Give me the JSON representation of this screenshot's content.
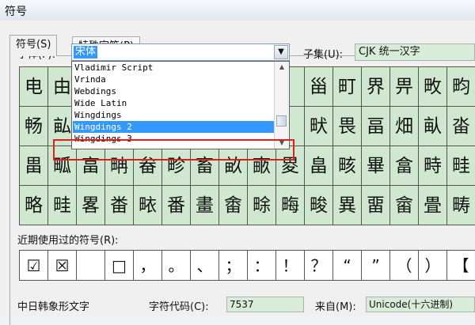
{
  "window": {
    "title": "符号"
  },
  "tabs": [
    {
      "label": "符号(S)"
    },
    {
      "label": "特殊字符(P)"
    }
  ],
  "font": {
    "label": "字体(F):",
    "selected": "宋体",
    "options": [
      "Vladimir Script",
      "Vrinda",
      "Webdings",
      "Wide Latin",
      "Wingdings",
      "Wingdings 2",
      "Wingdings 3"
    ],
    "highlighted": "Wingdings 2"
  },
  "subset": {
    "label": "子集(U):",
    "value": "CJK 统一汉字"
  },
  "symbol_grid": {
    "rows": [
      [
        "电",
        "由",
        "",
        "",
        "",
        "",
        "",
        "",
        "",
        "",
        "甾",
        "町",
        "界",
        "畀",
        "畋",
        "畇"
      ],
      [
        "畅",
        "畆",
        "",
        "",
        "",
        "",
        "",
        "",
        "",
        "",
        "畎",
        "畏",
        "畐",
        "畑",
        "畒",
        "畓"
      ],
      [
        "畕",
        "畖",
        "畗",
        "畘",
        "畚",
        "畛",
        "畜",
        "畝",
        "畞",
        "畟",
        "畠",
        "畡",
        "畢",
        "畣",
        "畤",
        "畦"
      ],
      [
        "略",
        "畦",
        "畧",
        "畨",
        "畩",
        "番",
        "畫",
        "畬",
        "畭",
        "畮",
        "畯",
        "異",
        "畱",
        "畲",
        "畳",
        "畴"
      ]
    ]
  },
  "recent": {
    "label": "近期使用过的符号(R):",
    "symbols": [
      "☑",
      "☒",
      "",
      "□",
      "，",
      "。",
      "、",
      "；",
      "：",
      "！",
      "？",
      "“",
      "”",
      "（",
      "）",
      "【"
    ]
  },
  "footer": {
    "char_name": "中日韩象形文字",
    "code_label": "字符代码(C):",
    "code_value": "7537",
    "from_label": "来自(M):",
    "from_value": "Unicode(十六进制)"
  },
  "colors": {
    "grid_bg": "#cfe8cf",
    "selection": "#3399ff",
    "highlight": "#e02020"
  }
}
